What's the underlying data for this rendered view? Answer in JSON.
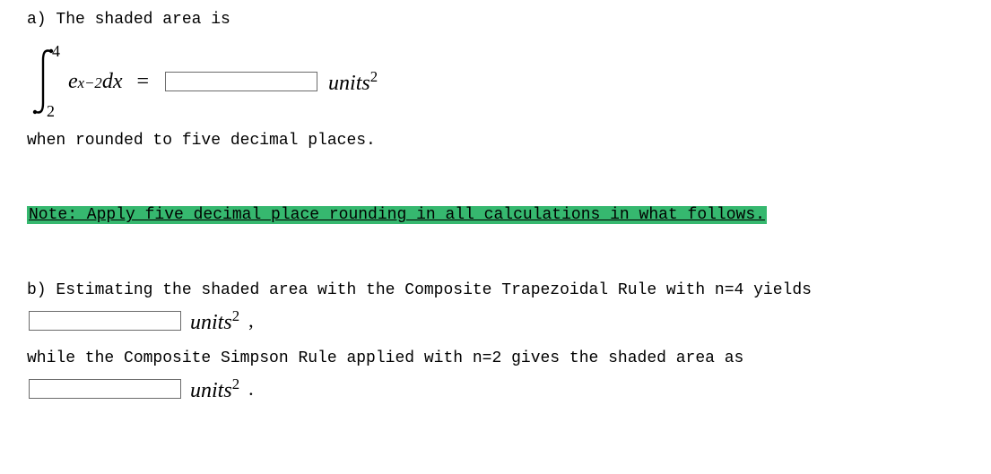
{
  "partA": {
    "label": "a) The shaded area is",
    "integral": {
      "lower": "2",
      "upper": "4",
      "integrand_base": "e",
      "integrand_exp": "x−2",
      "differential": "dx"
    },
    "equals": "=",
    "units_word": "units",
    "units_exp": "2",
    "rounding_text": "when rounded to five decimal places."
  },
  "note": {
    "text": "Note: Apply five decimal place rounding in all calculations in what follows."
  },
  "partB": {
    "label": "b) Estimating the shaded area with the Composite Trapezoidal Rule with n=4 yields",
    "units_word": "units",
    "units_exp": "2",
    "comma": ",",
    "simpson_text": "while the Composite Simpson Rule applied with n=2 gives the shaded area as",
    "period": "."
  }
}
